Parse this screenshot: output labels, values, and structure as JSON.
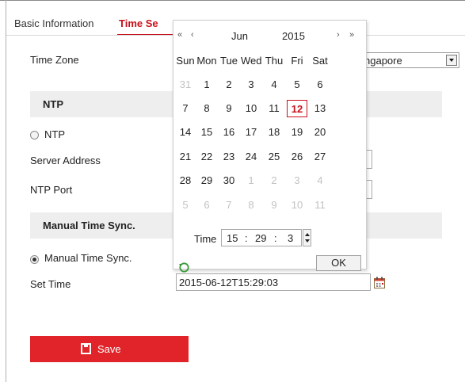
{
  "tabs": {
    "basic": "Basic Information",
    "time": "Time Se"
  },
  "form": {
    "time_zone_label": "Time Zone",
    "time_zone_value": "ngapore",
    "ntp_section": "NTP",
    "ntp_radio_label": "NTP",
    "server_address_label": "Server Address",
    "ntp_port_label": "NTP Port",
    "manual_section": "Manual Time Sync.",
    "manual_radio_label": "Manual Time Sync.",
    "set_time_label": "Set Time",
    "set_time_value": "2015-06-12T15:29:03",
    "save_label": "Save"
  },
  "calendar": {
    "nav_prev_year": "«",
    "nav_prev_month": "‹",
    "nav_next_month": "›",
    "nav_next_year": "»",
    "month": "Jun",
    "year": "2015",
    "weekdays": [
      "Sun",
      "Mon",
      "Tue",
      "Wed",
      "Thu",
      "Fri",
      "Sat"
    ],
    "weeks": [
      [
        {
          "d": "31",
          "m": true
        },
        {
          "d": "1"
        },
        {
          "d": "2"
        },
        {
          "d": "3"
        },
        {
          "d": "4"
        },
        {
          "d": "5"
        },
        {
          "d": "6"
        }
      ],
      [
        {
          "d": "7"
        },
        {
          "d": "8"
        },
        {
          "d": "9"
        },
        {
          "d": "10"
        },
        {
          "d": "11"
        },
        {
          "d": "12",
          "t": true
        },
        {
          "d": "13"
        }
      ],
      [
        {
          "d": "14"
        },
        {
          "d": "15"
        },
        {
          "d": "16"
        },
        {
          "d": "17"
        },
        {
          "d": "18"
        },
        {
          "d": "19"
        },
        {
          "d": "20"
        }
      ],
      [
        {
          "d": "21"
        },
        {
          "d": "22"
        },
        {
          "d": "23"
        },
        {
          "d": "24"
        },
        {
          "d": "25"
        },
        {
          "d": "26"
        },
        {
          "d": "27"
        }
      ],
      [
        {
          "d": "28"
        },
        {
          "d": "29"
        },
        {
          "d": "30"
        },
        {
          "d": "1",
          "m": true
        },
        {
          "d": "2",
          "m": true
        },
        {
          "d": "3",
          "m": true
        },
        {
          "d": "4",
          "m": true
        }
      ],
      [
        {
          "d": "5",
          "m": true
        },
        {
          "d": "6",
          "m": true
        },
        {
          "d": "7",
          "m": true
        },
        {
          "d": "8",
          "m": true
        },
        {
          "d": "9",
          "m": true
        },
        {
          "d": "10",
          "m": true
        },
        {
          "d": "11",
          "m": true
        }
      ]
    ],
    "time_label": "Time",
    "hour": "15",
    "minute": "29",
    "second": "3",
    "ok_label": "OK"
  },
  "colors": {
    "accent": "#c8101a",
    "save_bg": "#e02429"
  }
}
